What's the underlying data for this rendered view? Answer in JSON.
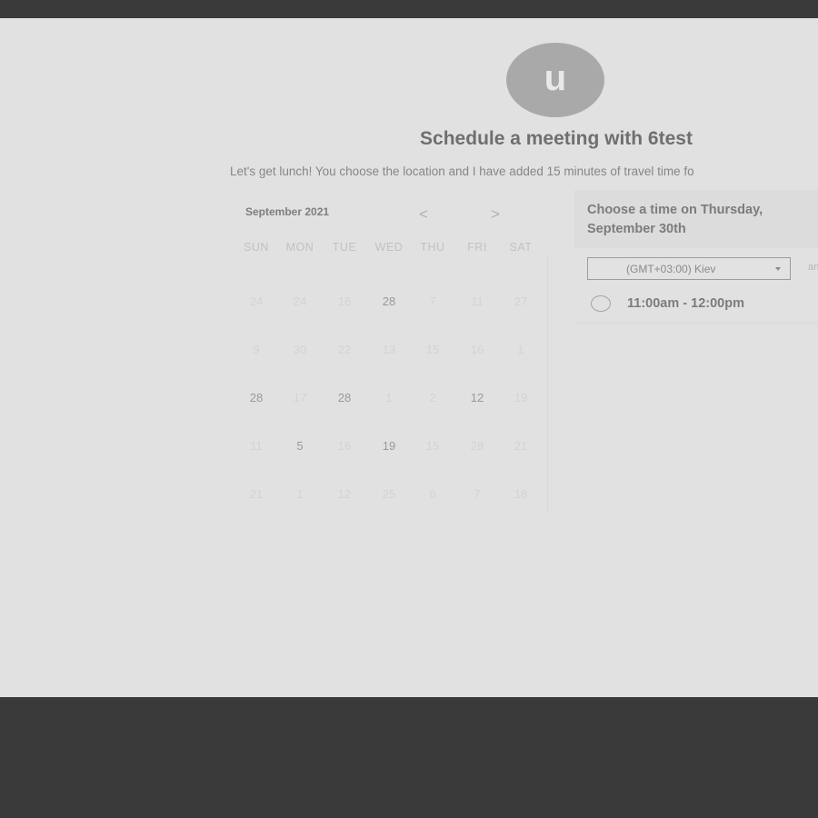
{
  "header": {
    "avatar_initial": "u",
    "title": "Schedule a meeting with 6test",
    "subtitle": "Let's get lunch! You choose the location and I have added 15 minutes of travel time fo"
  },
  "calendar": {
    "month_label": "September 2021",
    "prev_icon": "chevron-left-icon",
    "next_icon": "chevron-right-icon",
    "prev_glyph": "<",
    "next_glyph": ">",
    "weekdays": [
      "SUN",
      "MON",
      "TUE",
      "WED",
      "THU",
      "FRI",
      "SAT"
    ],
    "weeks": [
      [
        "24",
        "24",
        "18",
        "28",
        "7",
        "11",
        "27"
      ],
      [
        "9",
        "30",
        "22",
        "13",
        "15",
        "16",
        "1"
      ],
      [
        "28",
        "17",
        "28",
        "1",
        "2",
        "12",
        "19"
      ],
      [
        "11",
        "5",
        "16",
        "19",
        "15",
        "28",
        "21"
      ],
      [
        "21",
        "1",
        "12",
        "25",
        "6",
        "7",
        "18"
      ]
    ],
    "bright_days": [
      [
        0,
        3
      ],
      [
        2,
        0
      ],
      [
        2,
        2
      ],
      [
        2,
        5
      ],
      [
        3,
        1
      ],
      [
        3,
        3
      ]
    ]
  },
  "time_panel": {
    "heading": "Choose a time on Thursday, September 30th",
    "timezone": "(GMT+03:00) Kiev",
    "timezone_suffix": "an",
    "slot": "11:00am - 12:00pm"
  }
}
